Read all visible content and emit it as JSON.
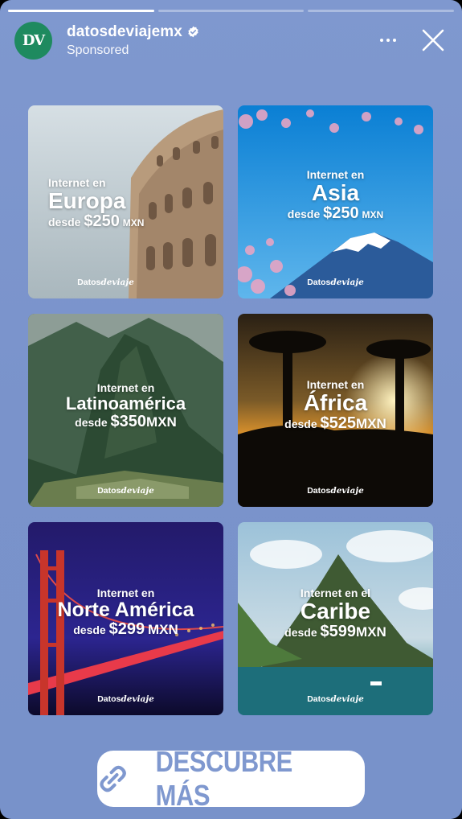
{
  "progress": [
    1,
    0,
    0
  ],
  "header": {
    "avatar_text": "DV",
    "username": "datosdeviajemx",
    "sponsored": "Sponsored"
  },
  "cards": [
    {
      "intro": "Internet en",
      "region": "Europa",
      "from": "desde",
      "price": "$250",
      "currency": "MXN",
      "logo_a": "Datos",
      "logo_b": "de",
      "logo_c": "viaje"
    },
    {
      "intro": "Internet en",
      "region": "Asia",
      "from": "desde",
      "price": "$250",
      "currency": "MXN",
      "logo_a": "Datos",
      "logo_b": "de",
      "logo_c": "viaje"
    },
    {
      "intro": "Internet en",
      "region": "Latinoamérica",
      "from": "desde",
      "price": "$350",
      "currency": "MXN",
      "logo_a": "Datos",
      "logo_b": "de",
      "logo_c": "viaje"
    },
    {
      "intro": "Internet en",
      "region": "África",
      "from": "desde",
      "price": "$525",
      "currency": "MXN",
      "logo_a": "Datos",
      "logo_b": "de",
      "logo_c": "viaje"
    },
    {
      "intro": "Internet en",
      "region": "Norte América",
      "from": "desde",
      "price": "$299",
      "currency": "MXN",
      "logo_a": "Datos",
      "logo_b": "de",
      "logo_c": "viaje"
    },
    {
      "intro": "Internet en el",
      "region": "Caribe",
      "from": "desde",
      "price": "$599",
      "currency": "MXN",
      "logo_a": "Datos",
      "logo_b": "de",
      "logo_c": "viaje"
    }
  ],
  "cta": {
    "label": "DESCUBRE MÁS"
  },
  "icons": [
    "verified-badge-icon",
    "more-options-icon",
    "close-icon",
    "link-icon"
  ],
  "colors": {
    "story_bg": "#7f98cf",
    "avatar": "#1e8a5f",
    "cta_text": "#7f98cf"
  }
}
